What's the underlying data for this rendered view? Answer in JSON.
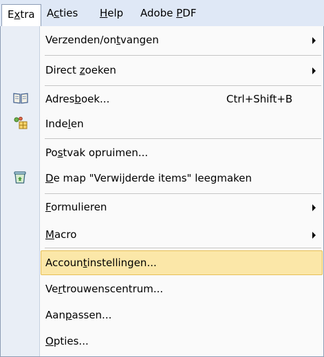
{
  "menubar": {
    "items": [
      {
        "pre": "E",
        "u": "x",
        "post": "tra"
      },
      {
        "pre": "A",
        "u": "c",
        "post": "ties"
      },
      {
        "pre": "",
        "u": "H",
        "post": "elp"
      },
      {
        "pre": "Adobe ",
        "u": "P",
        "post": "DF"
      }
    ]
  },
  "menu": {
    "items": [
      {
        "pre": "Verzenden/on",
        "u": "t",
        "post": "vangen"
      },
      {
        "pre": "Direct ",
        "u": "z",
        "post": "oeken"
      },
      {
        "pre": "Adres",
        "u": "b",
        "post": "oek...",
        "shortcut": "Ctrl+Shift+B",
        "icon": "address-book-icon"
      },
      {
        "pre": "Inde",
        "u": "l",
        "post": "en",
        "icon": "organize-icon"
      },
      {
        "pre": "Po",
        "u": "s",
        "post": "tvak opruimen..."
      },
      {
        "pre": "",
        "u": "D",
        "post": "e map \"Verwijderde items\" leegmaken",
        "icon": "recycle-bin-icon"
      },
      {
        "pre": "",
        "u": "F",
        "post": "ormulieren"
      },
      {
        "pre": "",
        "u": "M",
        "post": "acro"
      },
      {
        "pre": "Accoun",
        "u": "t",
        "post": "instellingen..."
      },
      {
        "pre": "Ve",
        "u": "r",
        "post": "trouwenscentrum..."
      },
      {
        "pre": "Aan",
        "u": "p",
        "post": "assen..."
      },
      {
        "pre": "",
        "u": "O",
        "post": "pties..."
      }
    ]
  },
  "colors": {
    "menubar_bg": "#dfe8f6",
    "gutter_bg": "#e9eef6",
    "highlight_bg": "#fbe7a8",
    "highlight_border": "#e7bf55"
  }
}
